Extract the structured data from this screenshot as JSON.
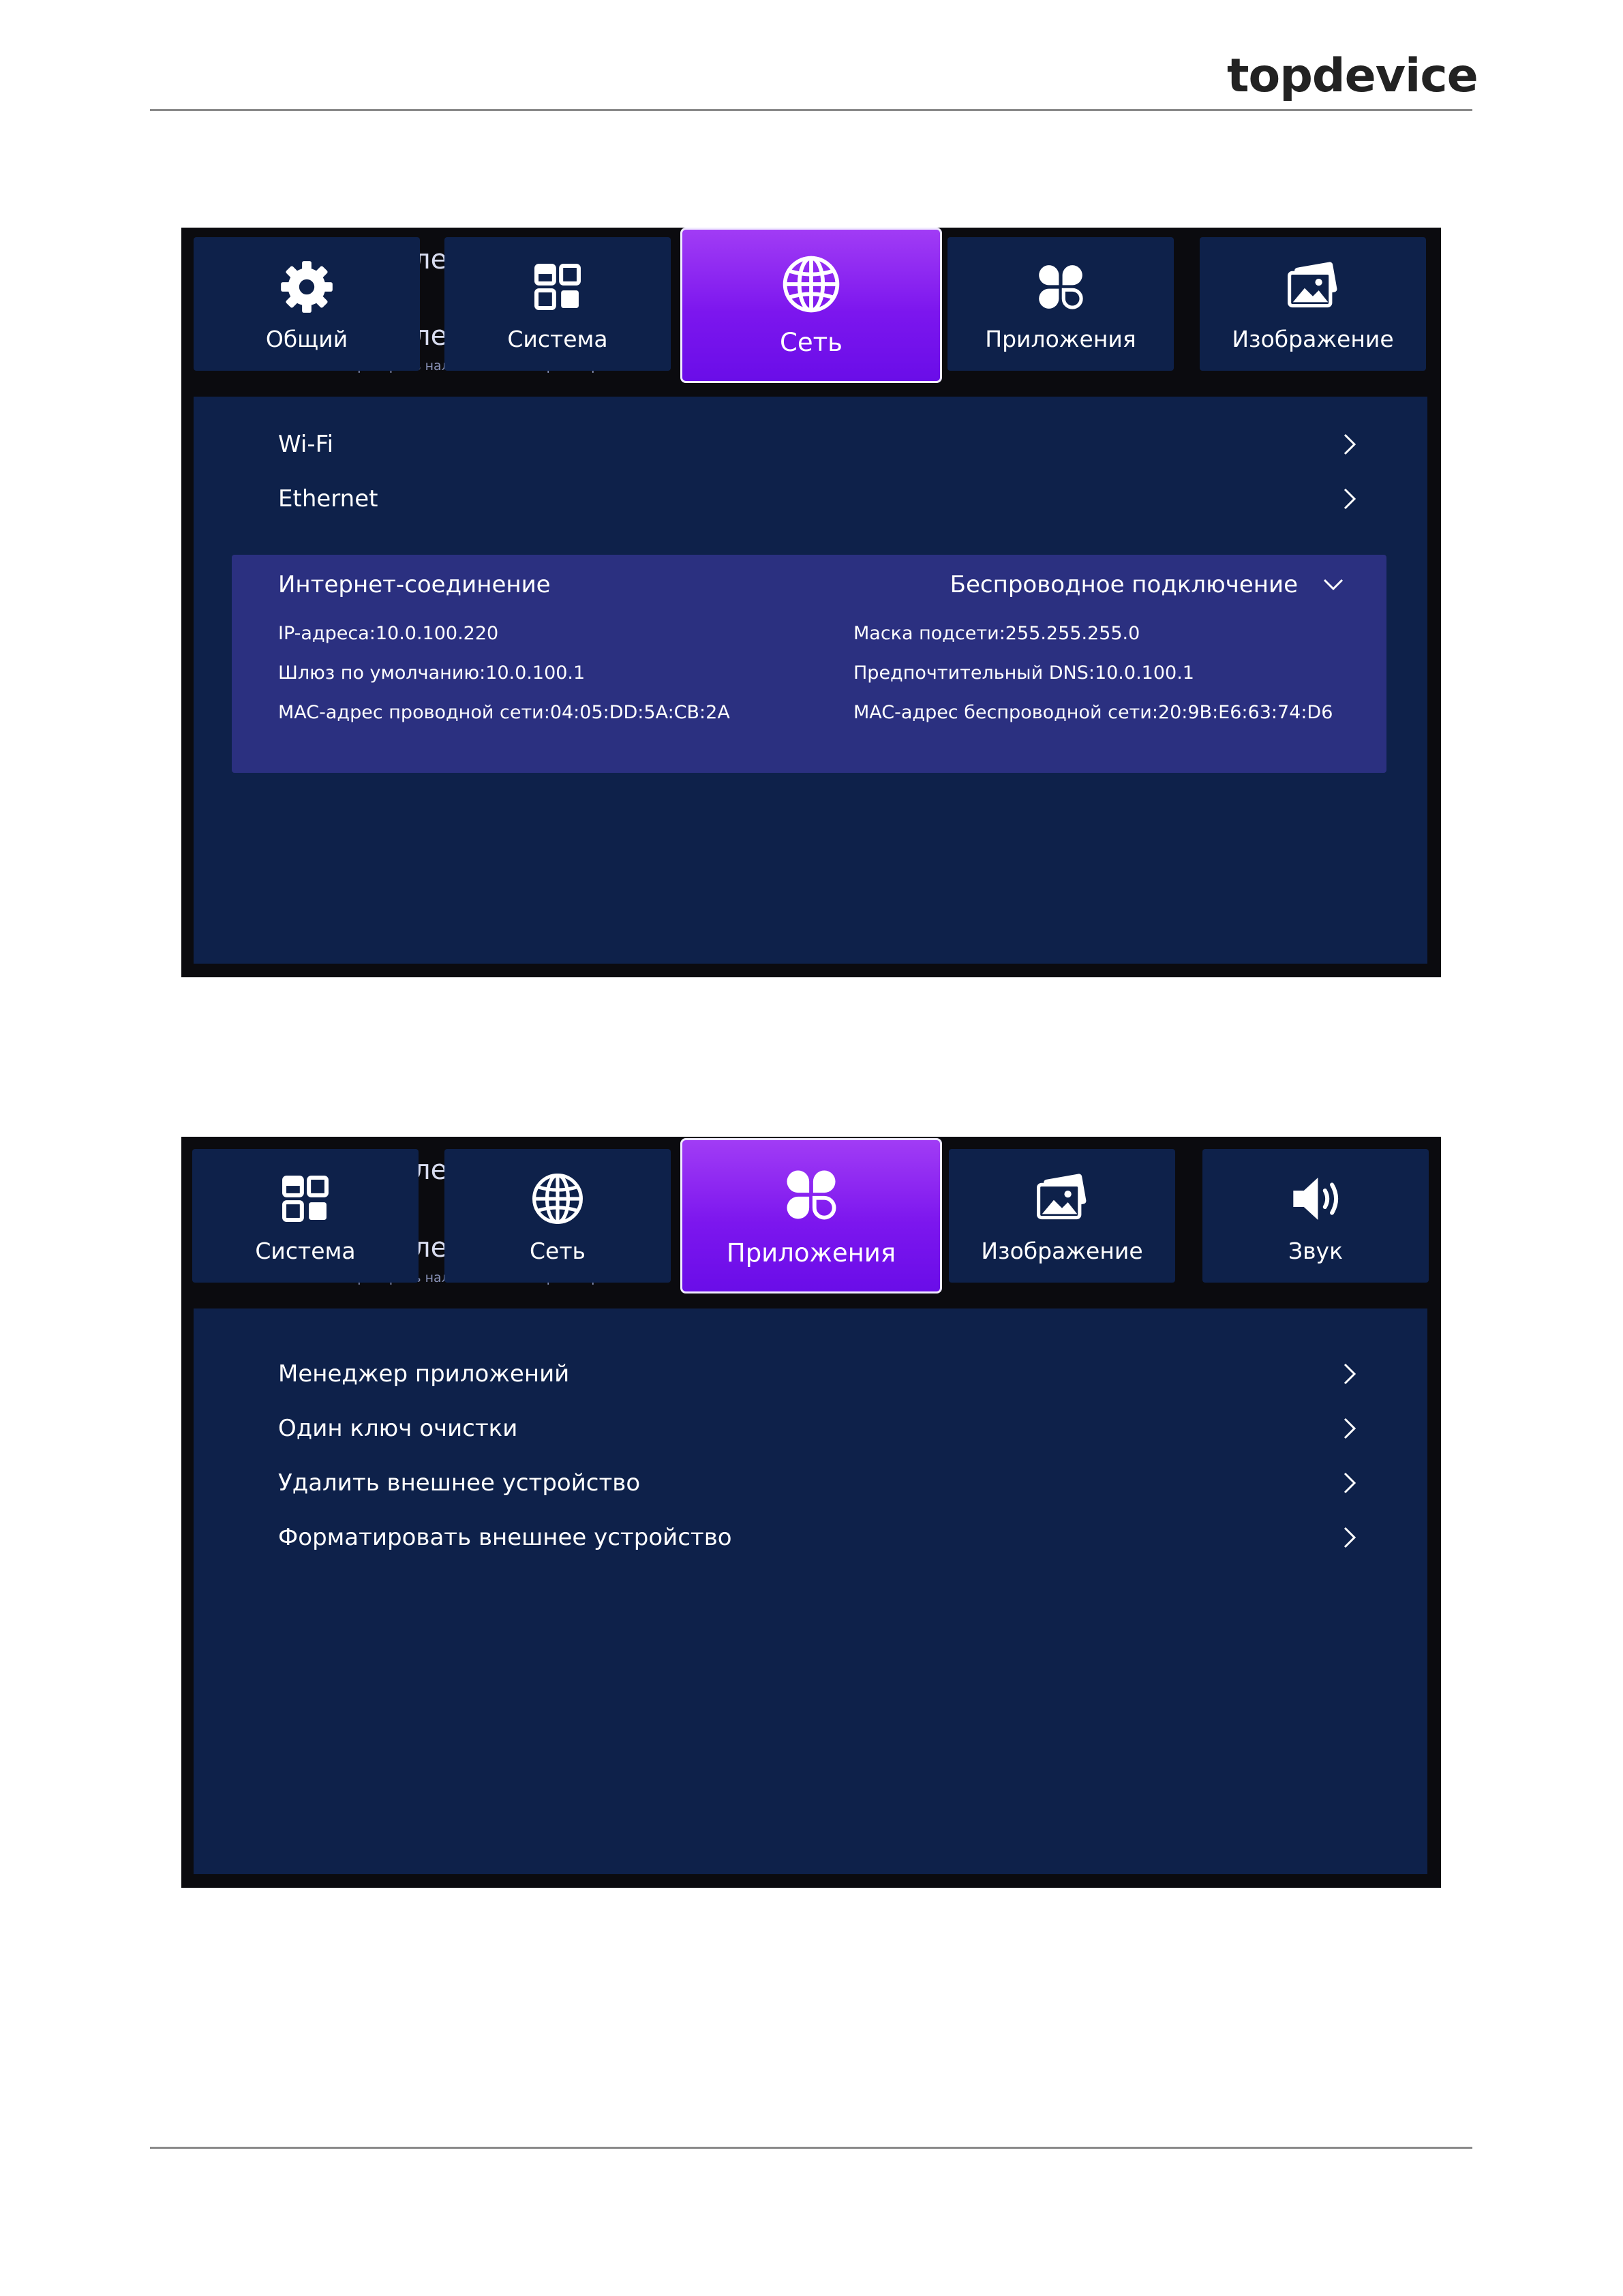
{
  "brand": {
    "logo_text": "topdevice"
  },
  "screen1": {
    "ghost": {
      "a": "ле",
      "b": "ле",
      "small": "Проверить наличие новой версии прошивки"
    },
    "tabs": [
      {
        "label": "Общий",
        "icon": "gear-icon"
      },
      {
        "label": "Система",
        "icon": "windows-icon"
      },
      {
        "label": "Сеть",
        "icon": "globe-icon",
        "active": true
      },
      {
        "label": "Приложения",
        "icon": "apps-clover-icon"
      },
      {
        "label": "Изображение",
        "icon": "image-icon"
      }
    ],
    "rows": [
      {
        "label": "Wi-Fi"
      },
      {
        "label": "Ethernet"
      }
    ],
    "internet": {
      "label": "Интернет-соединение",
      "value": "Беспроводное подключение",
      "ip": "IP-адреса:10.0.100.220",
      "mask": "Маска подсети:255.255.255.0",
      "gateway": "Шлюз по умолчанию:10.0.100.1",
      "dns": "Предпочтительный DNS:10.0.100.1",
      "mac_wired": "MAC-адрес проводной сети:04:05:DD:5A:CB:2A",
      "mac_wireless": "MAC-адрес беспроводной сети:20:9B:E6:63:74:D6"
    }
  },
  "screen2": {
    "ghost": {
      "a": "ле",
      "b": "ле",
      "small": "Проверить наличие новой версии прошивки"
    },
    "tabs": [
      {
        "label": "Система",
        "icon": "windows-icon"
      },
      {
        "label": "Сеть",
        "icon": "globe-icon"
      },
      {
        "label": "Приложения",
        "icon": "apps-clover-icon",
        "active": true
      },
      {
        "label": "Изображение",
        "icon": "image-icon"
      },
      {
        "label": "Звук",
        "icon": "speaker-icon"
      }
    ],
    "rows": [
      {
        "label": "Менеджер приложений"
      },
      {
        "label": "Один ключ очистки"
      },
      {
        "label": "Удалить внешнее устройство"
      },
      {
        "label": "Форматировать внешнее устройство"
      }
    ]
  },
  "colors": {
    "tab_bg": "#0e214a",
    "active_tab": "#7c16ee",
    "expanded_bg": "#2b3080",
    "frame": "#0b0b0f"
  }
}
